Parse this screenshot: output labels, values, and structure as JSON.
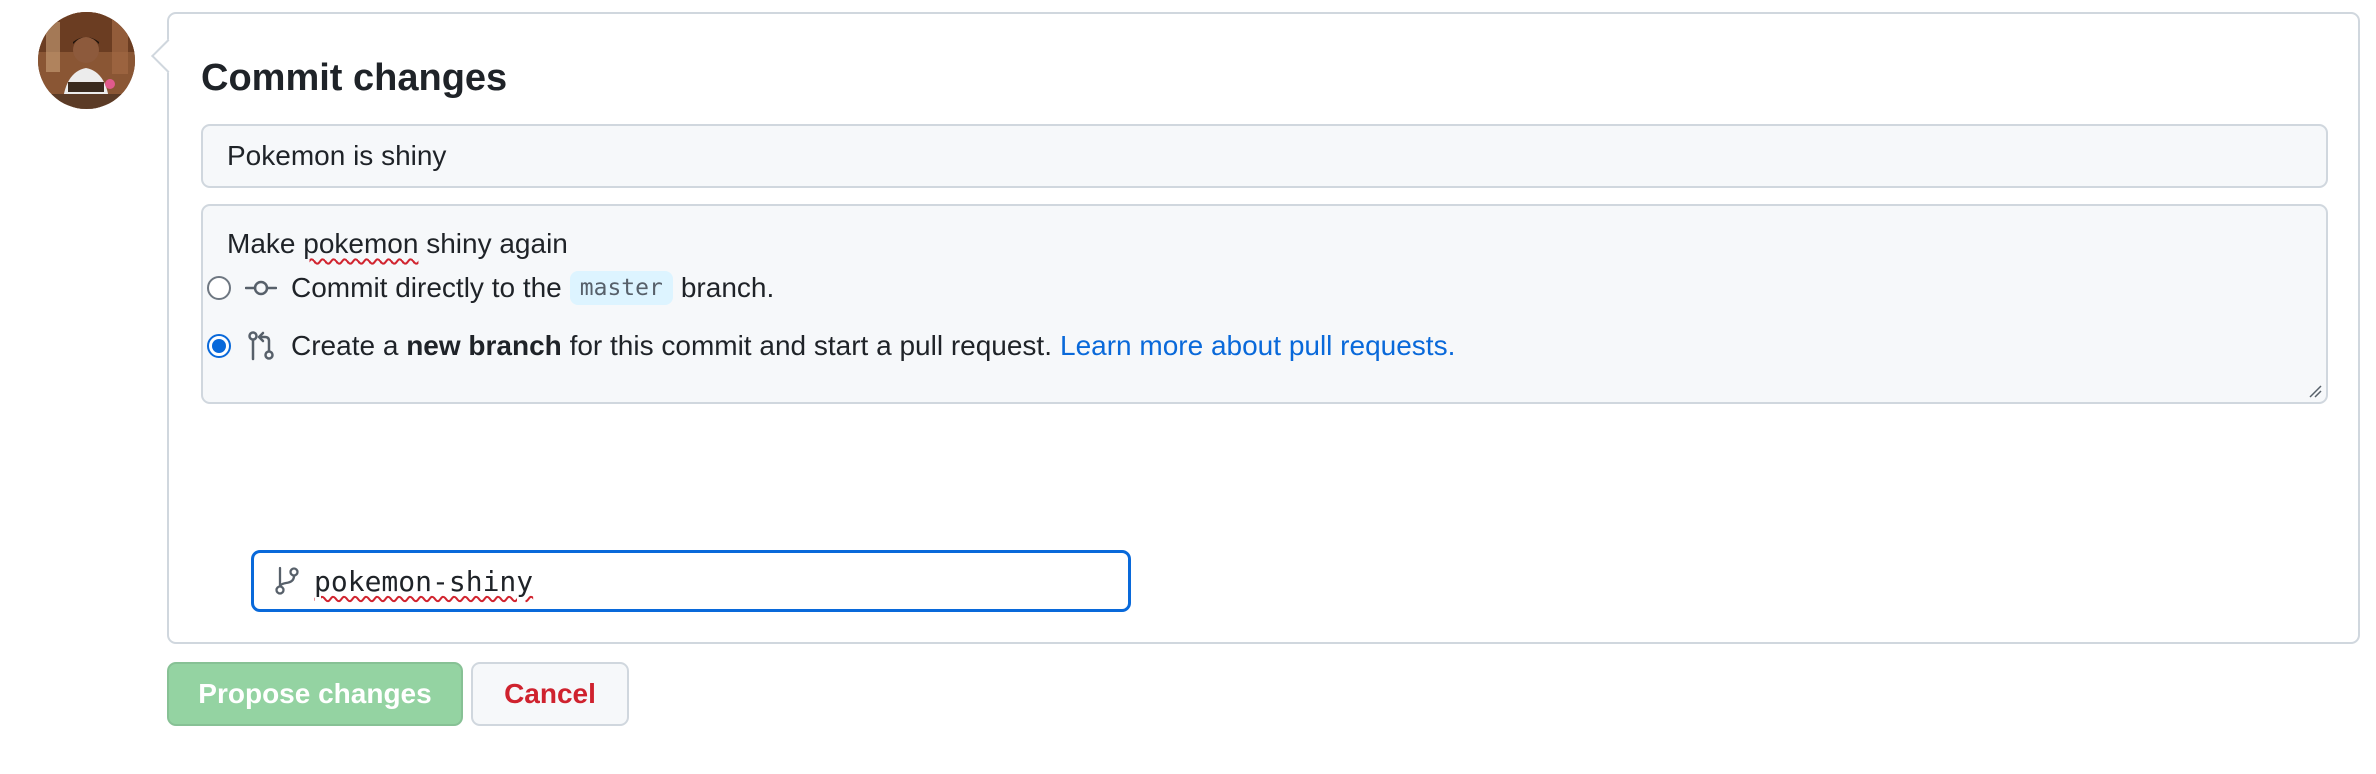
{
  "commit": {
    "title": "Commit changes",
    "summary_value": "Pokemon is shiny",
    "description_parts": [
      "Make ",
      "pokemon",
      " shiny again"
    ]
  },
  "options": {
    "direct": {
      "text_before": "Commit directly to the",
      "branch": "master",
      "text_after": "branch.",
      "checked": false
    },
    "new_branch": {
      "text_before": "Create a",
      "bold": "new branch",
      "text_after": "for this commit and start a pull request.",
      "link": "Learn more about pull requests.",
      "checked": true
    }
  },
  "branch_input": {
    "value": "pokemon-shiny"
  },
  "buttons": {
    "propose": "Propose changes",
    "cancel": "Cancel"
  },
  "colors": {
    "accent": "#0969da",
    "primary_disabled": "#94d3a2",
    "danger": "#cf222e",
    "border": "#d0d7de",
    "input_bg": "#f6f8fa"
  },
  "icons": {
    "commit": "git-commit-icon",
    "pull_request": "git-pull-request-icon",
    "branch": "git-branch-icon"
  }
}
